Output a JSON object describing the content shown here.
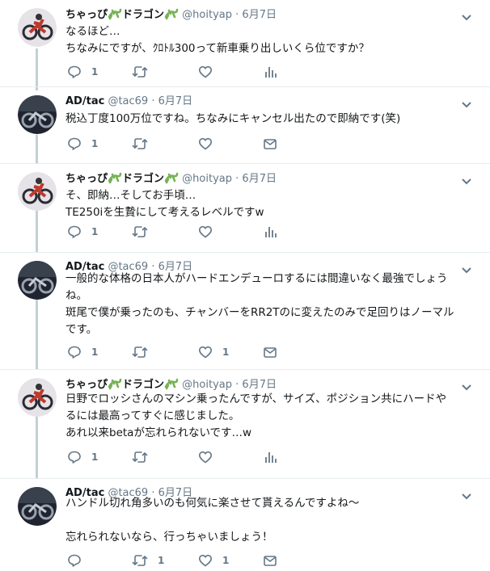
{
  "colors": {
    "thread_line": "#c4cfd6",
    "icon_gray": "#657786",
    "text": "#14171a",
    "divider": "#e6ecf0"
  },
  "tweets": [
    {
      "name": "ちゃっぴ",
      "name_suffix": "ドラゴン",
      "handle": "@hoityap",
      "dot": "·",
      "date": "6月7日",
      "lines": [
        "なるほど…",
        "ちなみにですが、ｸﾛﾄﾙ300って新車乗り出しいくら位ですか？"
      ],
      "reply_count": "1",
      "retweet_count": "",
      "like_count": "",
      "last_action_icon": "analytics-icon"
    },
    {
      "name": "AD/tac",
      "handle": "@tac69",
      "dot": "·",
      "date": "6月7日",
      "lines": [
        "税込丁度100万位ですね。ちなみにキャンセル出たので即納です(笑)"
      ],
      "reply_count": "1",
      "retweet_count": "",
      "like_count": "",
      "last_action_icon": "mail-icon"
    },
    {
      "name": "ちゃっぴ",
      "name_suffix": "ドラゴン",
      "handle": "@hoityap",
      "dot": "·",
      "date": "6月7日",
      "lines": [
        "そ、即納…そしてお手頃…",
        "TE250iを生贄にして考えるレベルですw"
      ],
      "reply_count": "1",
      "retweet_count": "",
      "like_count": "",
      "last_action_icon": "analytics-icon"
    },
    {
      "name": "AD/tac",
      "handle": "@tac69",
      "dot": "·",
      "date": "6月7日",
      "lines": [
        "一般的な体格の日本人がハードエンデューロするには間違いなく最強でしょう",
        "ね。",
        "斑尾で僕が乗ったのも、チャンバーをRR2Tのに変えたのみで足回りはノーマル",
        "です。"
      ],
      "reply_count": "1",
      "retweet_count": "",
      "like_count": "1",
      "last_action_icon": "mail-icon"
    },
    {
      "name": "ちゃっぴ",
      "name_suffix": "ドラゴン",
      "handle": "@hoityap",
      "dot": "·",
      "date": "6月7日",
      "lines": [
        "日野でロッシさんのマシン乗ったんですが、サイズ、ポジション共にハードや",
        "るには最高ってすぐに感じました。",
        "あれ以来betaが忘れられないです…w"
      ],
      "reply_count": "1",
      "retweet_count": "",
      "like_count": "",
      "last_action_icon": "analytics-icon"
    },
    {
      "name": "AD/tac",
      "handle": "@tac69",
      "dot": "·",
      "date": "6月7日",
      "lines": [
        "ハンドル切れ角多いのも何気に楽させて貰えるんですよね〜",
        "",
        "忘れられないなら、行っちゃいましょう！"
      ],
      "reply_count": "",
      "retweet_count": "1",
      "like_count": "1",
      "last_action_icon": "mail-icon"
    }
  ]
}
